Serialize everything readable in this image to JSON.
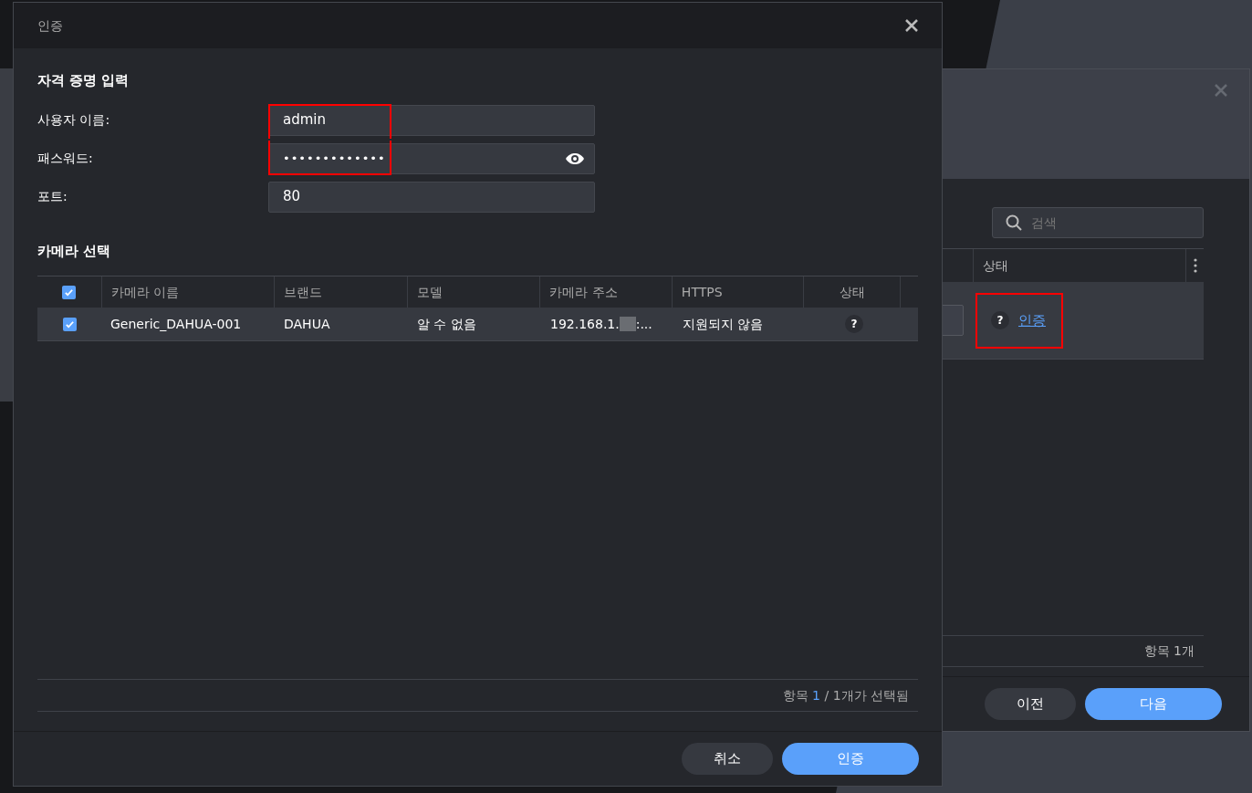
{
  "dialog": {
    "title": "인증",
    "credentials_heading": "자격 증명 입력",
    "fields": [
      {
        "kind": "text",
        "label": "사용자 이름:",
        "value": "admin",
        "highlighted": true
      },
      {
        "kind": "password",
        "label": "패스워드:",
        "value": "•••••••••••••",
        "highlighted": true
      },
      {
        "kind": "text",
        "label": "포트:",
        "value": "80",
        "highlighted": false
      }
    ],
    "camera_heading": "카메라 선택",
    "table": {
      "select_all_checked": true,
      "columns": [
        "카메라 이름",
        "브랜드",
        "모델",
        "카메라 주소",
        "HTTPS",
        "상태"
      ],
      "rows": [
        {
          "checked": true,
          "selected": true,
          "name": "Generic_DAHUA-001",
          "brand": "DAHUA",
          "model": "알 수 없음",
          "address_prefix": "192.168.1.",
          "address_suffix": ":...",
          "https": "지원되지 않음",
          "status": "?"
        }
      ]
    },
    "footer_summary": {
      "prefix": "항목",
      "count": "1",
      "rest": "/ 1개가 선택됨"
    },
    "buttons": [
      {
        "label": "취소",
        "kind": "secondary"
      },
      {
        "label": "인증",
        "kind": "primary"
      }
    ]
  },
  "background_dialog": {
    "search": {
      "placeholder": "검색"
    },
    "column": "상태",
    "row": {
      "status_icon": "?",
      "link": "인증",
      "highlighted": true
    },
    "footer_summary": "항목 1개",
    "buttons": [
      {
        "label": "이전",
        "kind": "secondary"
      },
      {
        "label": "다음",
        "kind": "primary"
      }
    ]
  }
}
